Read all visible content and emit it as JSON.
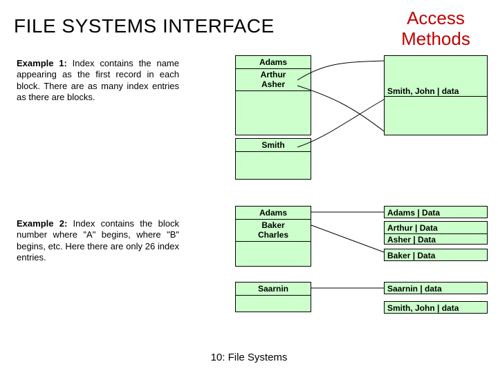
{
  "title_left": "FILE SYSTEMS INTERFACE",
  "title_right_line1": "Access",
  "title_right_line2": "Methods",
  "example1": {
    "heading": "Example 1:",
    "body": " Index contains the name appearing as the first record in each block. There are as many index entries as there are blocks."
  },
  "example2": {
    "heading": "Example 2:",
    "body": " Index contains the block number where \"A\" begins, where \"B\" begins, etc. Here there are only 26 index entries."
  },
  "ex1_index": {
    "r1": "Adams",
    "r2a": "Arthur",
    "r2b": "Asher",
    "r3": "Smith"
  },
  "ex1_data": {
    "r1": "Smith, John | data"
  },
  "ex2_index": {
    "r1": "Adams",
    "r2a": "Baker",
    "r2b": "Charles",
    "r3": "Saarnin"
  },
  "ex2_data": {
    "r1": "Adams   | Data",
    "r2": "Arthur   | Data",
    "r3": "Asher   | Data",
    "r4": "Baker   | Data",
    "r5": "Saarnin | data",
    "r6": "Smith, John | data"
  },
  "footer": "10: File Systems"
}
